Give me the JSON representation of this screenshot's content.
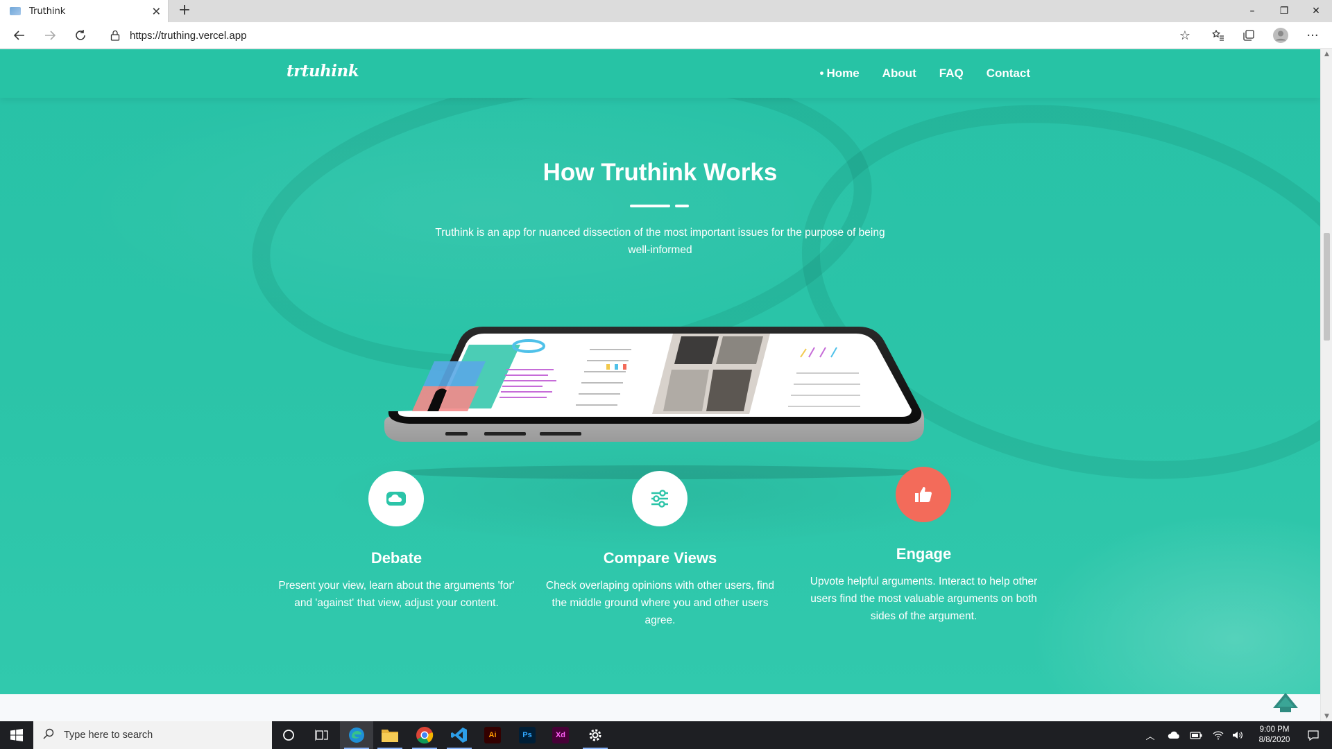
{
  "browser": {
    "tab_title": "Truthink",
    "tab_close": "✕",
    "new_tab": "+",
    "url": "https://truthing.vercel.app",
    "window_controls": {
      "minimize": "–",
      "maximize": "❐",
      "close": "✕"
    },
    "icons": [
      "back-icon",
      "forward-icon",
      "refresh-icon",
      "lock-icon",
      "star-icon",
      "favorites-icon",
      "collections-icon",
      "profile-icon",
      "more-icon"
    ]
  },
  "nav": {
    "logo": "trtuhink",
    "links": [
      {
        "label": "Home",
        "active": true
      },
      {
        "label": "About"
      },
      {
        "label": "FAQ"
      },
      {
        "label": "Contact"
      }
    ]
  },
  "hero": {
    "title": "How Truthink Works",
    "subtitle": "Truthink is an app for nuanced dissection of the most important issues for the purpose of being well-informed"
  },
  "features": [
    {
      "icon": "cloud-icon",
      "title": "Debate",
      "description": "Present your view, learn about the arguments 'for' and 'against' that view, adjust your content."
    },
    {
      "icon": "sliders-icon",
      "title": "Compare Views",
      "description": "Check overlaping opinions with other users, find the middle ground where you and other users agree."
    },
    {
      "icon": "thumbs-up-icon",
      "title": "Engage",
      "description": "Upvote helpful arguments. Interact to help other users find the most valuable arguments on both sides of the argument."
    }
  ],
  "colors": {
    "primary": "#2bc4a8",
    "accent": "#f36b5a",
    "text": "#ffffff"
  },
  "taskbar": {
    "search_placeholder": "Type here to search",
    "apps": [
      "cortana",
      "task-view",
      "edge",
      "file-explorer",
      "chrome",
      "vscode",
      "illustrator",
      "photoshop",
      "xd",
      "settings"
    ],
    "app_labels": {
      "illustrator": "Ai",
      "photoshop": "Ps",
      "xd": "Xd"
    },
    "time": "9:00 PM",
    "date": "8/8/2020"
  }
}
